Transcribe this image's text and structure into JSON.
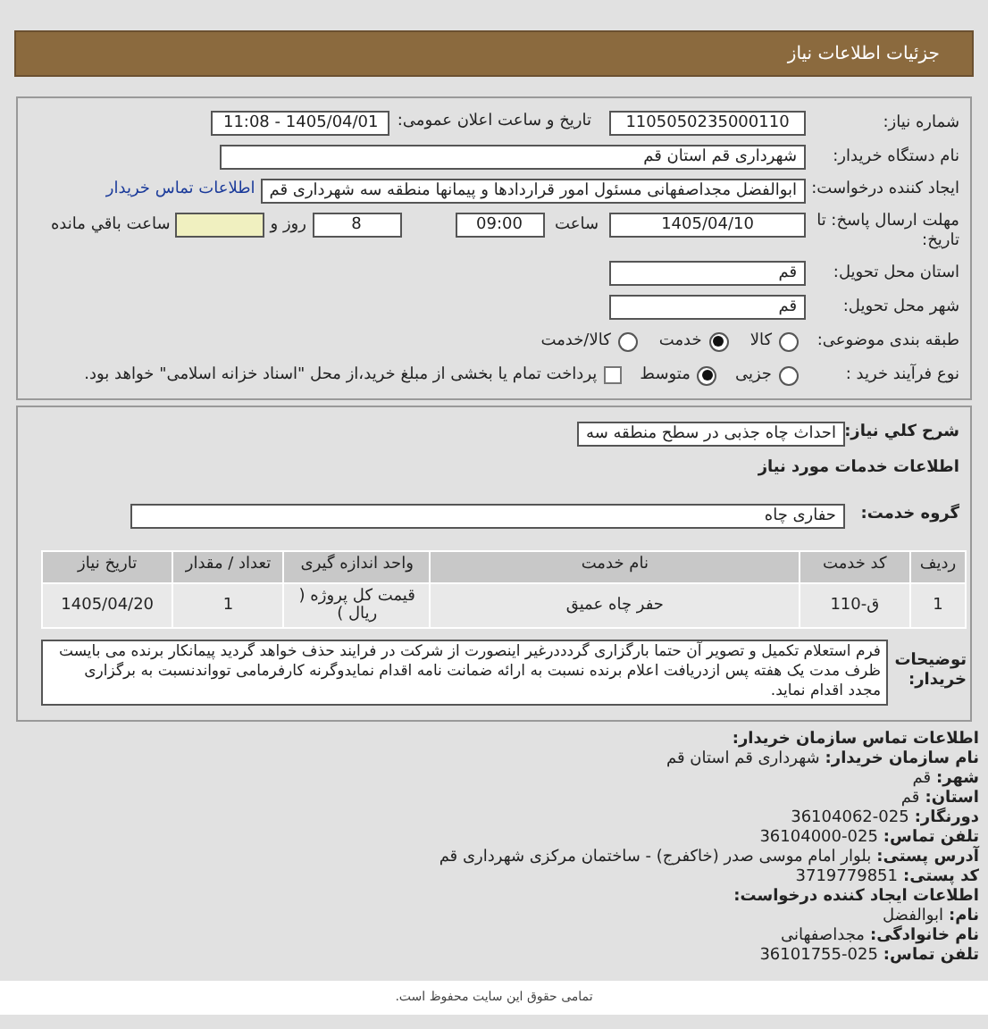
{
  "header": {
    "title": "جزئیات اطلاعات نیاز"
  },
  "need_number": {
    "label": "شماره نیاز:",
    "value": "1105050235000110"
  },
  "announce": {
    "label": "تاریخ و ساعت اعلان عمومی:",
    "value": "1405/04/01 - 11:08"
  },
  "buyer_org": {
    "label": "نام دستگاه خریدار:",
    "value": "شهرداری قم استان قم"
  },
  "requester": {
    "label": "ایجاد کننده درخواست:",
    "value": "ابوالفضل مجداصفهانی مسئول امور قراردادها و پیمانها منطقه سه شهرداری قم",
    "link": "اطلاعات تماس خریدار"
  },
  "deadline": {
    "label": "مهلت ارسال پاسخ: تا تاریخ:",
    "date": "1405/04/10",
    "time_label": "ساعت",
    "time": "09:00",
    "days": "8",
    "days_label": "روز و",
    "remaining_label": "ساعت باقي مانده"
  },
  "province": {
    "label": "استان محل تحویل:",
    "value": "قم"
  },
  "city": {
    "label": "شهر محل تحویل:",
    "value": "قم"
  },
  "category": {
    "label": "طبقه بندی موضوعی:",
    "options": [
      {
        "label": "کالا",
        "selected": false
      },
      {
        "label": "خدمت",
        "selected": true
      },
      {
        "label": "کالا/خدمت",
        "selected": false
      }
    ]
  },
  "purchase_type": {
    "label": "نوع فرآیند خرید :",
    "options": [
      {
        "label": "جزیی",
        "selected": false
      },
      {
        "label": "متوسط",
        "selected": true
      }
    ],
    "checkbox": {
      "label": "پرداخت تمام یا بخشی از مبلغ خرید،از محل \"اسناد خزانه اسلامی\" خواهد بود.",
      "checked": false
    }
  },
  "description": {
    "label": "شرح كلي نياز:",
    "value": "احداث چاه جذبی در سطح منطقه سه"
  },
  "services_title": "اطلاعات خدمات مورد نیاز",
  "service_group": {
    "label": "گروه خدمت:",
    "value": "حفاری چاه"
  },
  "table": {
    "columns": [
      "ردیف",
      "کد خدمت",
      "نام خدمت",
      "واحد اندازه گیری",
      "تعداد / مقدار",
      "تاریخ نیاز"
    ],
    "rows": [
      [
        "1",
        "ق-110",
        "حفر چاه عمیق",
        "قیمت کل پروژه ( ریال )",
        "1",
        "1405/04/20"
      ]
    ]
  },
  "buyer_notes": {
    "label": "توضیحات خریدار:",
    "value": "فرم استعلام تکمیل و تصویر آن حتما بارگزاری گردددرغیر اینصورت از شرکت در فرایند حذف خواهد گردید پیمانکار برنده می بایست ظرف مدت یک هفته پس ازدریافت اعلام برنده نسبت به ارائه ضمانت نامه اقدام نمایدوگرنه کارفرمامی توواندنسبت به برگزاری مجدد اقدام نماید."
  },
  "contact": {
    "title": "اطلاعات تماس سازمان خریدار:",
    "lines": [
      {
        "label": "نام سازمان خریدار:",
        "value": "شهرداری قم استان قم"
      },
      {
        "label": "شهر:",
        "value": "قم"
      },
      {
        "label": "استان:",
        "value": "قم"
      },
      {
        "label": "دورنگار:",
        "value": "36104062-025"
      },
      {
        "label": "تلفن تماس:",
        "value": "36104000-025"
      },
      {
        "label": "آدرس پستی:",
        "value": "بلوار امام موسی صدر (خاکفرج) - ساختمان مرکزی شهرداری قم"
      },
      {
        "label": "کد پستی:",
        "value": "3719779851"
      }
    ]
  },
  "creator": {
    "title": "اطلاعات ایجاد کننده درخواست:",
    "lines": [
      {
        "label": "نام:",
        "value": "ابوالفضل"
      },
      {
        "label": "نام خانوادگی:",
        "value": "مجداصفهانی"
      },
      {
        "label": "تلفن تماس:",
        "value": "36101755-025"
      }
    ]
  },
  "footer": {
    "text": "تمامی حقوق این سایت محفوظ است."
  }
}
